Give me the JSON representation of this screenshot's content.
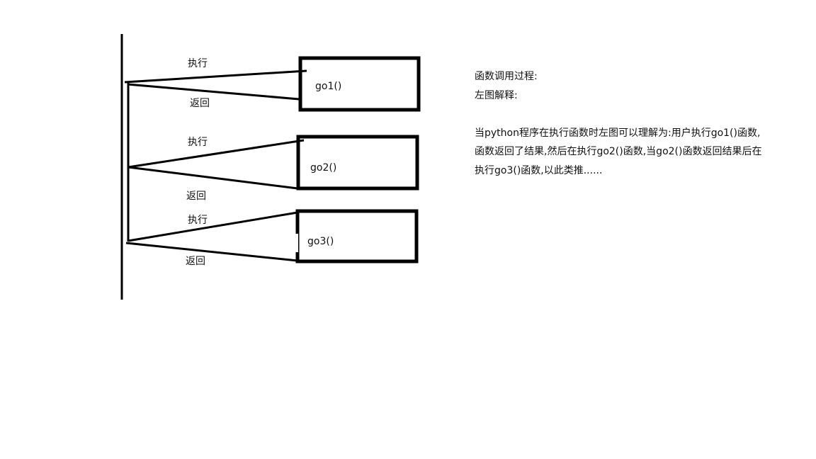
{
  "diagram": {
    "calls": [
      {
        "function": "go1()",
        "call_label": "执行",
        "return_label": "返回"
      },
      {
        "function": "go2()",
        "call_label": "执行",
        "return_label": "返回"
      },
      {
        "function": "go3()",
        "call_label": "执行",
        "return_label": "返回"
      }
    ]
  },
  "notes": {
    "title": "函数调用过程:",
    "subtitle": "左图解释:",
    "lines": [
      "当python程序在执行函数时左图可以理解为:用户执行go1()函数,",
      "函数返回了结果,然后在执行go2()函数,当go2()函数返回结果后在",
      "执行go3()函数,以此类推......"
    ]
  },
  "colors": {
    "stroke": "#000000",
    "text": "#111111"
  }
}
